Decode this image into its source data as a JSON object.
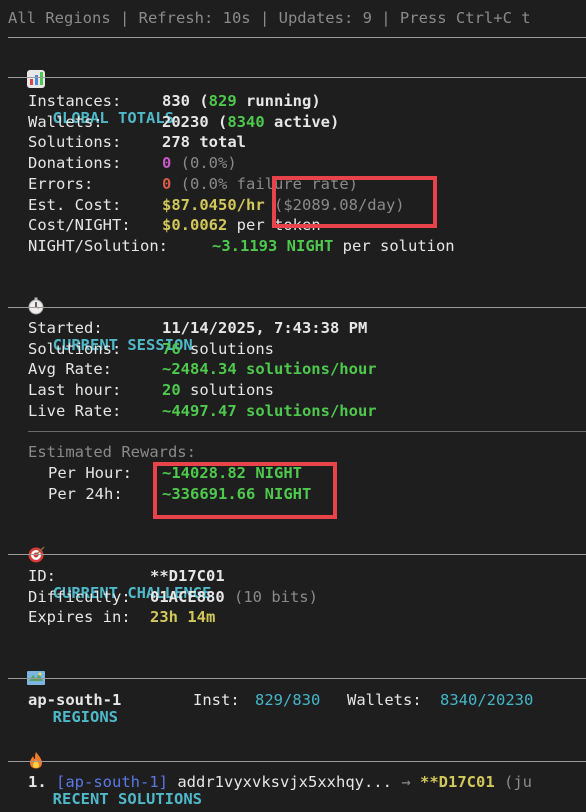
{
  "topbar": "All Regions | Refresh: 10s | Updates: 9 | Press Ctrl+C t",
  "global": {
    "title": "GLOBAL TOTALS",
    "icon": "bar-chart-icon",
    "instances_label": "Instances:",
    "instances_value": "830",
    "instances_open": " (",
    "instances_running": "829",
    "instances_close": " running)",
    "wallets_label": "Wallets:",
    "wallets_value": "20230",
    "wallets_open": " (",
    "wallets_active": "8340",
    "wallets_close": " active)",
    "solutions_label": "Solutions:",
    "solutions_value": "278 total",
    "donations_label": "Donations:",
    "donations_value": "0",
    "donations_pct": " (0.0%)",
    "errors_label": "Errors:",
    "errors_value": "0",
    "errors_rate": " (0.0% failure rate)",
    "cost_label": "Est. Cost:",
    "cost_value": "$87.0450/hr",
    "cost_day": " ($2089.08/day)",
    "costnight_label": "Cost/NIGHT:",
    "costnight_value": "$0.0062",
    "costnight_suffix": " per token",
    "nps_label": "NIGHT/Solution:",
    "nps_value": "~3.1193 NIGHT",
    "nps_suffix": " per solution"
  },
  "session": {
    "title": "CURRENT SESSION",
    "icon": "stopwatch-icon",
    "started_label": "Started:",
    "started_value": "11/14/2025, 7:43:38 PM",
    "solutions_label": "Solutions:",
    "solutions_value": "76",
    "solutions_suffix": " solutions",
    "avg_label": "Avg Rate:",
    "avg_value": "~2484.34 solutions/hour",
    "last_label": "Last hour:",
    "last_value": "20",
    "last_suffix": " solutions",
    "live_label": "Live Rate:",
    "live_value": "~4497.47 solutions/hour",
    "est_label": "Estimated Rewards:",
    "perhour_label": "Per Hour:",
    "perhour_value": "~14028.82 NIGHT",
    "per24_label": "Per 24h:",
    "per24_value": "~336691.66 NIGHT"
  },
  "challenge": {
    "title": "CURRENT CHALLENGE",
    "icon": "target-icon",
    "id_label": "ID:",
    "id_value": "**D17C01",
    "diff_label": "Difficulty:",
    "diff_value": "01ACE880",
    "diff_bits": " (10 bits)",
    "exp_label": "Expires in:",
    "exp_value": "23h 14m"
  },
  "regions": {
    "title": "REGIONS",
    "icon": "map-icon",
    "name": "ap-south-1",
    "inst_label": "Inst:",
    "inst_value": "829/830",
    "wallets_label": "Wallets:",
    "wallets_value": "8340/20230"
  },
  "recent": {
    "title": "RECENT SOLUTIONS",
    "icon": "fire-icon",
    "index": "1.",
    "region": "[ap-south-1]",
    "address": "addr1vyxvksvjx5xxhqy...",
    "arrow": "→",
    "challenge": "**D17C01",
    "tail": " (ju"
  }
}
